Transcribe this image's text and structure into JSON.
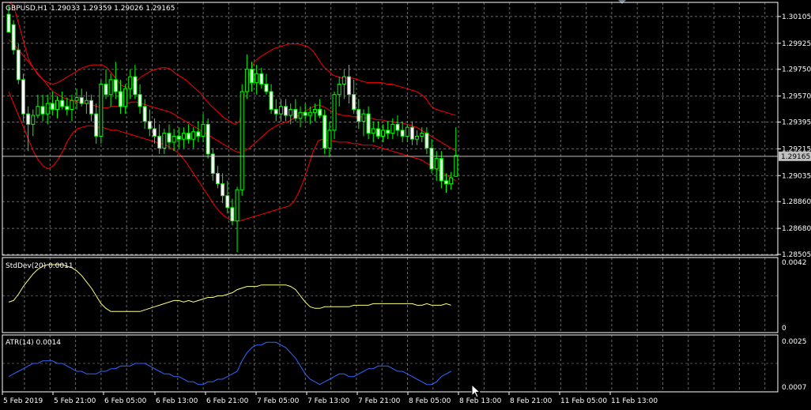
{
  "symbol_label": "GBPUSD,H1",
  "ohlc_label": "1.29033 1.29359 1.29026 1.29165",
  "current_price_label": "1.29165",
  "colors": {
    "background": "#000000",
    "grid": "#c0c0c0",
    "bull_candle": "#00ff00",
    "bear_candle": "#ffffff",
    "wick": "#00ff00",
    "bollinger": "#ff0000",
    "stddev": "#ffff80",
    "atr": "#3366ff",
    "price_line": "#c0c0c0"
  },
  "price_axis": {
    "ticks": [
      "1.30105",
      "1.29925",
      "1.29750",
      "1.29570",
      "1.29395",
      "1.29215",
      "1.29035",
      "1.28860",
      "1.28680",
      "1.28505"
    ]
  },
  "stddev_panel": {
    "label": "StdDev(20) 0.0011",
    "ticks": [
      "0.0042",
      "0"
    ]
  },
  "atr_panel": {
    "label": "ATR(14) 0.0014",
    "ticks": [
      "0.0025",
      "0.0007"
    ]
  },
  "time_axis": {
    "labels": [
      "5 Feb 2019",
      "5 Feb 21:00",
      "6 Feb 05:00",
      "6 Feb 13:00",
      "6 Feb 21:00",
      "7 Feb 05:00",
      "7 Feb 13:00",
      "7 Feb 21:00",
      "8 Feb 05:00",
      "8 Feb 13:00",
      "8 Feb 21:00",
      "11 Feb 05:00",
      "11 Feb 13:00"
    ]
  },
  "chart_data": [
    {
      "type": "candlestick",
      "title": "GBPUSD,H1",
      "ylim": [
        1.285,
        1.302
      ],
      "candles": [
        [
          1.3012,
          1.3018,
          1.3005,
          1.3
        ],
        [
          1.3005,
          1.3008,
          1.2985,
          1.2988
        ],
        [
          1.2988,
          1.2992,
          1.2965,
          1.2968
        ],
        [
          1.2968,
          1.2972,
          1.294,
          1.2945
        ],
        [
          1.2945,
          1.295,
          1.292,
          1.2938
        ],
        [
          1.2938,
          1.2948,
          1.293,
          1.2944
        ],
        [
          1.2944,
          1.2958,
          1.2942,
          1.295
        ],
        [
          1.295,
          1.2958,
          1.294,
          1.2945
        ],
        [
          1.2945,
          1.2958,
          1.2938,
          1.2952
        ],
        [
          1.2952,
          1.296,
          1.2944,
          1.2948
        ],
        [
          1.2948,
          1.2957,
          1.2942,
          1.2954
        ],
        [
          1.2954,
          1.296,
          1.2948,
          1.295
        ],
        [
          1.295,
          1.2956,
          1.2944,
          1.2948
        ],
        [
          1.2948,
          1.2958,
          1.294,
          1.2954
        ],
        [
          1.2954,
          1.2962,
          1.2948,
          1.2956
        ],
        [
          1.2956,
          1.2962,
          1.295,
          1.2952
        ],
        [
          1.2952,
          1.296,
          1.2945,
          1.2954
        ],
        [
          1.2954,
          1.2958,
          1.294,
          1.2945
        ],
        [
          1.2945,
          1.2952,
          1.2925,
          1.293
        ],
        [
          1.293,
          1.2968,
          1.2925,
          1.2965
        ],
        [
          1.2965,
          1.2975,
          1.2955,
          1.2958
        ],
        [
          1.2958,
          1.2972,
          1.295,
          1.2968
        ],
        [
          1.2968,
          1.298,
          1.2955,
          1.296
        ],
        [
          1.296,
          1.2968,
          1.2945,
          1.295
        ],
        [
          1.295,
          1.2965,
          1.2945,
          1.2962
        ],
        [
          1.2962,
          1.2975,
          1.2955,
          1.297
        ],
        [
          1.297,
          1.2978,
          1.2955,
          1.2958
        ],
        [
          1.2958,
          1.2965,
          1.2945,
          1.295
        ],
        [
          1.295,
          1.2955,
          1.2935,
          1.294
        ],
        [
          1.294,
          1.2948,
          1.293,
          1.2935
        ],
        [
          1.2935,
          1.2942,
          1.2925,
          1.293
        ],
        [
          1.293,
          1.2938,
          1.2918,
          1.2922
        ],
        [
          1.2922,
          1.2935,
          1.2918,
          1.2932
        ],
        [
          1.2932,
          1.2938,
          1.2922,
          1.2926
        ],
        [
          1.2926,
          1.2935,
          1.292,
          1.293
        ],
        [
          1.293,
          1.2936,
          1.2922,
          1.2928
        ],
        [
          1.2928,
          1.2936,
          1.2922,
          1.2932
        ],
        [
          1.2932,
          1.2938,
          1.2925,
          1.2928
        ],
        [
          1.2928,
          1.2936,
          1.2922,
          1.2933
        ],
        [
          1.2933,
          1.294,
          1.2926,
          1.293
        ],
        [
          1.293,
          1.2945,
          1.2926,
          1.2938
        ],
        [
          1.2938,
          1.2942,
          1.2915,
          1.2918
        ],
        [
          1.2918,
          1.2922,
          1.29,
          1.2905
        ],
        [
          1.2905,
          1.291,
          1.2895,
          1.2898
        ],
        [
          1.2898,
          1.2905,
          1.2885,
          1.289
        ],
        [
          1.289,
          1.29,
          1.2878,
          1.2882
        ],
        [
          1.2882,
          1.2888,
          1.287,
          1.2873
        ],
        [
          1.2873,
          1.2896,
          1.2852,
          1.2894
        ],
        [
          1.2894,
          1.2965,
          1.289,
          1.296
        ],
        [
          1.296,
          1.2985,
          1.2955,
          1.2975
        ],
        [
          1.2975,
          1.298,
          1.296,
          1.2966
        ],
        [
          1.2966,
          1.2978,
          1.2958,
          1.2972
        ],
        [
          1.2972,
          1.2976,
          1.2962,
          1.2965
        ],
        [
          1.2965,
          1.2972,
          1.2958,
          1.296
        ],
        [
          1.296,
          1.2965,
          1.2945,
          1.2948
        ],
        [
          1.2948,
          1.2955,
          1.294,
          1.2945
        ],
        [
          1.2945,
          1.2955,
          1.294,
          1.295
        ],
        [
          1.295,
          1.2955,
          1.294,
          1.2944
        ],
        [
          1.2944,
          1.2952,
          1.2938,
          1.2948
        ],
        [
          1.2948,
          1.2955,
          1.294,
          1.2942
        ],
        [
          1.2942,
          1.295,
          1.2936,
          1.2946
        ],
        [
          1.2946,
          1.2952,
          1.294,
          1.2944
        ],
        [
          1.2944,
          1.295,
          1.2938,
          1.2946
        ],
        [
          1.2946,
          1.2952,
          1.294,
          1.2948
        ],
        [
          1.2948,
          1.2955,
          1.2942,
          1.2944
        ],
        [
          1.2944,
          1.2948,
          1.2918,
          1.2922
        ],
        [
          1.2922,
          1.294,
          1.2916,
          1.2934
        ],
        [
          1.2934,
          1.296,
          1.2928,
          1.2958
        ],
        [
          1.2958,
          1.297,
          1.295,
          1.2965
        ],
        [
          1.2965,
          1.2975,
          1.2955,
          1.297
        ],
        [
          1.297,
          1.2978,
          1.2952,
          1.2958
        ],
        [
          1.2958,
          1.2968,
          1.2945,
          1.2948
        ],
        [
          1.2948,
          1.2955,
          1.2935,
          1.294
        ],
        [
          1.294,
          1.2948,
          1.293,
          1.2945
        ],
        [
          1.2945,
          1.295,
          1.2928,
          1.2932
        ],
        [
          1.2932,
          1.294,
          1.2926,
          1.2935
        ],
        [
          1.2935,
          1.294,
          1.2928,
          1.293
        ],
        [
          1.293,
          1.2938,
          1.2926,
          1.2934
        ],
        [
          1.2934,
          1.294,
          1.2928,
          1.2932
        ],
        [
          1.2932,
          1.2942,
          1.2928,
          1.2938
        ],
        [
          1.2938,
          1.2944,
          1.293,
          1.2934
        ],
        [
          1.2934,
          1.294,
          1.2926,
          1.293
        ],
        [
          1.293,
          1.2938,
          1.2926,
          1.2936
        ],
        [
          1.2936,
          1.294,
          1.2924,
          1.2928
        ],
        [
          1.2928,
          1.2934,
          1.2924,
          1.293
        ],
        [
          1.293,
          1.2936,
          1.2926,
          1.2932
        ],
        [
          1.2932,
          1.2936,
          1.2918,
          1.2922
        ],
        [
          1.2922,
          1.2928,
          1.2905,
          1.2908
        ],
        [
          1.2908,
          1.292,
          1.29,
          1.2915
        ],
        [
          1.2915,
          1.292,
          1.2895,
          1.29
        ],
        [
          1.29,
          1.2905,
          1.2892,
          1.2898
        ],
        [
          1.2898,
          1.2906,
          1.2894,
          1.2902
        ],
        [
          1.2903,
          1.2936,
          1.2903,
          1.2917
        ]
      ],
      "bollinger_upper": [
        1.303,
        1.3018,
        1.3006,
        1.2994,
        1.2982,
        1.2976,
        1.2971,
        1.2968,
        1.2966,
        1.2965,
        1.2966,
        1.2968,
        1.297,
        1.2972,
        1.2974,
        1.2976,
        1.2977,
        1.2978,
        1.2978,
        1.2978,
        1.2976,
        1.2972,
        1.2968,
        1.2964,
        1.2963,
        1.2964,
        1.2967,
        1.297,
        1.2972,
        1.2974,
        1.2975,
        1.2976,
        1.2976,
        1.2975,
        1.2972,
        1.297,
        1.2968,
        1.2965,
        1.2962,
        1.2959,
        1.2955,
        1.2951,
        1.2948,
        1.2945,
        1.2942,
        1.294,
        1.2938,
        1.294,
        1.2958,
        1.2972,
        1.298,
        1.2983,
        1.2985,
        1.2987,
        1.2989,
        1.299,
        1.2991,
        1.2992,
        1.2992,
        1.2992,
        1.2991,
        1.299,
        1.2987,
        1.2982,
        1.2977,
        1.2974,
        1.2971,
        1.297,
        1.2969,
        1.2969,
        1.2969,
        1.2968,
        1.2967,
        1.2966,
        1.2966,
        1.2966,
        1.2966,
        1.2965,
        1.2965,
        1.2964,
        1.2963,
        1.2962,
        1.2961,
        1.296,
        1.2958,
        1.2955,
        1.295,
        1.2948,
        1.2947,
        1.2946,
        1.2945,
        1.2944
      ],
      "bollinger_middle": [
        1.2995,
        1.2992,
        1.2988,
        1.2984,
        1.298,
        1.2976,
        1.2972,
        1.2968,
        1.2964,
        1.296,
        1.2958,
        1.2956,
        1.2955,
        1.2954,
        1.2953,
        1.2952,
        1.2952,
        1.2951,
        1.295,
        1.2949,
        1.2949,
        1.295,
        1.295,
        1.2951,
        1.2952,
        1.2953,
        1.2953,
        1.2952,
        1.2951,
        1.295,
        1.2949,
        1.2948,
        1.2947,
        1.2946,
        1.2944,
        1.2942,
        1.294,
        1.2938,
        1.2936,
        1.2934,
        1.2932,
        1.293,
        1.2928,
        1.2926,
        1.2924,
        1.2922,
        1.292,
        1.2919,
        1.292,
        1.2922,
        1.2925,
        1.2928,
        1.2931,
        1.2934,
        1.2936,
        1.2938,
        1.2939,
        1.294,
        1.2942,
        1.2944,
        1.2946,
        1.2948,
        1.295,
        1.2951,
        1.295,
        1.2948,
        1.2946,
        1.2945,
        1.2944,
        1.2944,
        1.2943,
        1.2943,
        1.2943,
        1.2942,
        1.2942,
        1.2941,
        1.2941,
        1.294,
        1.294,
        1.2939,
        1.2939,
        1.2938,
        1.2937,
        1.2936,
        1.2934,
        1.2932,
        1.293,
        1.2928,
        1.2926,
        1.2924,
        1.2922,
        1.292
      ],
      "bollinger_lower": [
        1.296,
        1.2952,
        1.2944,
        1.2936,
        1.2928,
        1.292,
        1.2914,
        1.291,
        1.2908,
        1.291,
        1.2914,
        1.292,
        1.2927,
        1.2932,
        1.2935,
        1.2936,
        1.2937,
        1.2937,
        1.2936,
        1.2936,
        1.2935,
        1.2934,
        1.2934,
        1.2933,
        1.2932,
        1.2931,
        1.293,
        1.2929,
        1.2928,
        1.2927,
        1.2926,
        1.2925,
        1.2924,
        1.2922,
        1.292,
        1.2917,
        1.2913,
        1.2908,
        1.2903,
        1.2898,
        1.2893,
        1.2888,
        1.2883,
        1.2879,
        1.2876,
        1.2874,
        1.2873,
        1.2873,
        1.2874,
        1.2875,
        1.2876,
        1.2877,
        1.2878,
        1.2879,
        1.288,
        1.2881,
        1.2882,
        1.2883,
        1.2886,
        1.2892,
        1.29,
        1.291,
        1.292,
        1.2927,
        1.2928,
        1.2927,
        1.2927,
        1.2926,
        1.2926,
        1.2926,
        1.2925,
        1.2925,
        1.2924,
        1.2924,
        1.2924,
        1.2923,
        1.2922,
        1.2921,
        1.292,
        1.2919,
        1.2918,
        1.2917,
        1.2916,
        1.2915,
        1.2914,
        1.2912,
        1.291,
        1.2908,
        1.2906,
        1.2904,
        1.2902,
        1.29
      ]
    },
    {
      "type": "line",
      "title": "StdDev(20) 0.0011",
      "ylim": [
        0,
        0.0042
      ],
      "values": [
        0.0017,
        0.0018,
        0.0022,
        0.0027,
        0.0031,
        0.0035,
        0.0038,
        0.004,
        0.0041,
        0.0041,
        0.0041,
        0.0041,
        0.004,
        0.0039,
        0.0037,
        0.0034,
        0.003,
        0.0026,
        0.0021,
        0.0016,
        0.0013,
        0.0011,
        0.0011,
        0.0011,
        0.0011,
        0.0011,
        0.0011,
        0.0011,
        0.0012,
        0.0013,
        0.0014,
        0.0015,
        0.0016,
        0.0017,
        0.0018,
        0.0018,
        0.0017,
        0.0018,
        0.0017,
        0.0018,
        0.0019,
        0.002,
        0.002,
        0.0021,
        0.0021,
        0.0022,
        0.0023,
        0.0025,
        0.0026,
        0.0027,
        0.0027,
        0.0027,
        0.0028,
        0.0028,
        0.0028,
        0.0028,
        0.0028,
        0.0028,
        0.0027,
        0.0025,
        0.0021,
        0.0017,
        0.0014,
        0.0013,
        0.0013,
        0.0014,
        0.0014,
        0.0014,
        0.0014,
        0.0014,
        0.0014,
        0.0015,
        0.0015,
        0.0015,
        0.0015,
        0.0016,
        0.0016,
        0.0016,
        0.0016,
        0.0016,
        0.0016,
        0.0016,
        0.0016,
        0.0016,
        0.0015,
        0.0015,
        0.0016,
        0.0015,
        0.0015,
        0.0015,
        0.0016,
        0.0015
      ]
    },
    {
      "type": "line",
      "title": "ATR(14) 0.0014",
      "ylim": [
        0.0007,
        0.0025
      ],
      "values": [
        0.0011,
        0.0012,
        0.0013,
        0.0014,
        0.0015,
        0.0016,
        0.0016,
        0.0017,
        0.0017,
        0.0017,
        0.0016,
        0.0016,
        0.0015,
        0.0014,
        0.0013,
        0.0013,
        0.0012,
        0.0012,
        0.0012,
        0.0013,
        0.0013,
        0.0014,
        0.0014,
        0.0015,
        0.0015,
        0.0015,
        0.0016,
        0.0016,
        0.0016,
        0.0015,
        0.0014,
        0.0013,
        0.0012,
        0.0012,
        0.0011,
        0.0011,
        0.001,
        0.0009,
        0.0009,
        0.0008,
        0.0008,
        0.0009,
        0.0009,
        0.001,
        0.001,
        0.0011,
        0.0012,
        0.0013,
        0.0017,
        0.002,
        0.0022,
        0.0023,
        0.0023,
        0.0024,
        0.0024,
        0.0024,
        0.0023,
        0.0022,
        0.002,
        0.0018,
        0.0015,
        0.0012,
        0.001,
        0.0009,
        0.0008,
        0.0009,
        0.001,
        0.0011,
        0.0012,
        0.0012,
        0.0011,
        0.0011,
        0.0012,
        0.0013,
        0.0014,
        0.0014,
        0.0015,
        0.0015,
        0.0015,
        0.0014,
        0.0013,
        0.0013,
        0.0012,
        0.0011,
        0.001,
        0.0009,
        0.0008,
        0.0008,
        0.0009,
        0.0011,
        0.0012,
        0.0013
      ]
    }
  ]
}
